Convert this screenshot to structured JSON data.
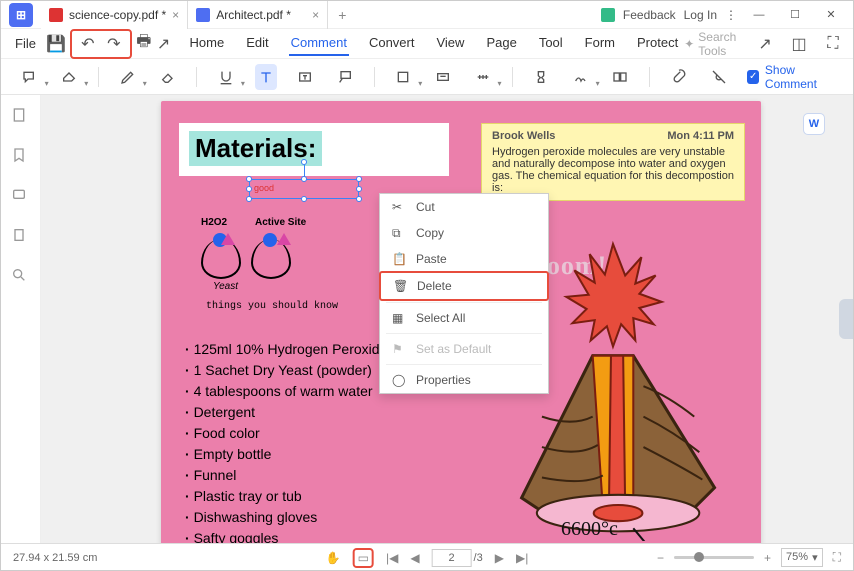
{
  "titlebar": {
    "tabs": [
      {
        "label": "science-copy.pdf *",
        "active": true
      },
      {
        "label": "Architect.pdf *",
        "active": false
      }
    ],
    "feedback": "Feedback",
    "login": "Log In"
  },
  "menubar": {
    "file": "File",
    "items": [
      "Home",
      "Edit",
      "Comment",
      "Convert",
      "View",
      "Page",
      "Tool",
      "Form",
      "Protect"
    ],
    "active_index": 2,
    "search_placeholder": "Search Tools"
  },
  "toolbar": {
    "show_comment": "Show Comment"
  },
  "document": {
    "materials_title": "Materials:",
    "textbox_text": "good",
    "diagram_labels": {
      "h2o2": "H2O2",
      "active_site": "Active Site",
      "yeast": "Yeast"
    },
    "subtitle": "things you should know",
    "list": [
      "125ml 10% Hydrogen Peroxide",
      "1 Sachet Dry Yeast (powder)",
      "4 tablespoons of warm water",
      "Detergent",
      "Food color",
      "Empty bottle",
      "Funnel",
      "Plastic tray or tub",
      "Dishwashing gloves",
      "Safty goggles"
    ],
    "note": {
      "author": "Brook Wells",
      "time": "Mon 4:11 PM",
      "body": "Hydrogen peroxide molecules are very unstable and naturally decompose into water and oxygen gas. The chemical equation for this decompostion is:"
    },
    "boom_text": "bOOoom!",
    "temp_text": "6600°c"
  },
  "context_menu": {
    "items": [
      {
        "label": "Cut",
        "key": "cut"
      },
      {
        "label": "Copy",
        "key": "copy"
      },
      {
        "label": "Paste",
        "key": "paste"
      },
      {
        "label": "Delete",
        "key": "delete",
        "highlighted": true
      },
      {
        "label": "Select All",
        "key": "select-all"
      },
      {
        "label": "Set as Default",
        "key": "set-default",
        "disabled": true
      },
      {
        "label": "Properties",
        "key": "properties"
      }
    ]
  },
  "statusbar": {
    "dimensions": "27.94 x 21.59 cm",
    "page_current": "2",
    "page_total": "/3",
    "zoom": "75%"
  }
}
